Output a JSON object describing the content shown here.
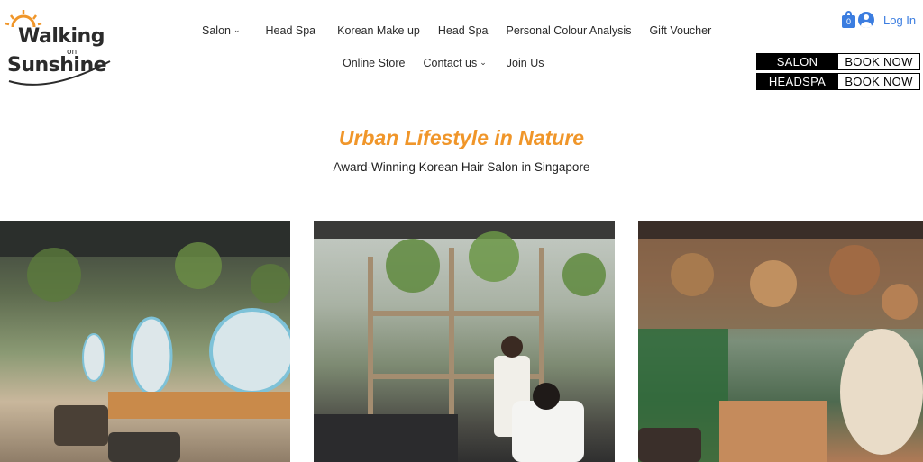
{
  "brand": {
    "logo_line1": "Walking",
    "logo_line2": "on",
    "logo_line3": "Sunshine"
  },
  "nav": {
    "row1": [
      {
        "label": "Salon",
        "dropdown": true
      },
      {
        "label": "Head Spa"
      },
      {
        "label": "Korean Make up"
      },
      {
        "label": "Head Spa"
      },
      {
        "label": "Personal Colour Analysis"
      },
      {
        "label": "Gift Voucher"
      }
    ],
    "row2": [
      {
        "label": "Online Store"
      },
      {
        "label": "Contact us",
        "dropdown": true
      },
      {
        "label": "Join Us"
      }
    ]
  },
  "account": {
    "cart_count": "0",
    "login_label": "Log In"
  },
  "booking": [
    {
      "category": "SALON",
      "button": "BOOK NOW"
    },
    {
      "category": "HEADSPA",
      "button": "BOOK NOW"
    }
  ],
  "hero": {
    "title": "Urban Lifestyle in Nature",
    "subtitle": "Award-Winning Korean Hair Salon in Singapore"
  },
  "colors": {
    "accent_orange": "#f0962a",
    "link_blue": "#3b7de0",
    "book_black": "#000000"
  }
}
